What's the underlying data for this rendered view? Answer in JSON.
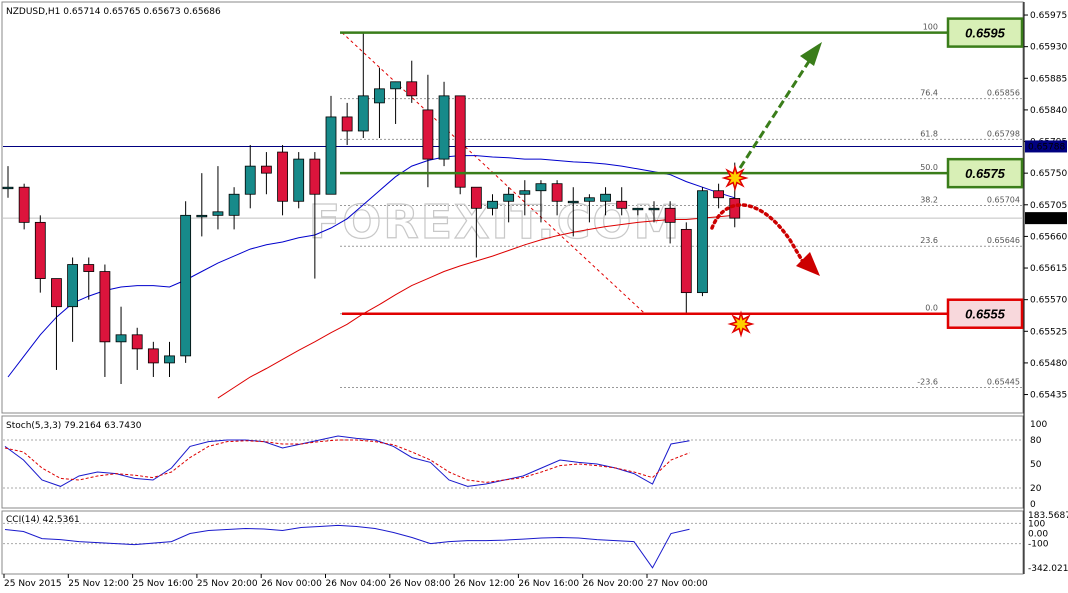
{
  "chart_data": {
    "type": "candlestick",
    "symbol_header": "NZDUSD,H1  0.65714 0.65765 0.65673 0.65686",
    "watermark": "FOREXIT.COM",
    "price_axis": {
      "ticks": [
        "0.65975",
        "0.65930",
        "0.65885",
        "0.65840",
        "0.65795",
        "0.65750",
        "0.65705",
        "0.65660",
        "0.65615",
        "0.65570",
        "0.65525",
        "0.65480",
        "0.65435"
      ],
      "ylim": [
        0.65413,
        0.65985
      ],
      "current_price_label": "0.65686",
      "hline_label": "0.65788"
    },
    "time_axis": {
      "labels": [
        "25 Nov 2015",
        "25 Nov 12:00",
        "25 Nov 16:00",
        "25 Nov 20:00",
        "26 Nov 00:00",
        "26 Nov 04:00",
        "26 Nov 08:00",
        "26 Nov 12:00",
        "26 Nov 16:00",
        "26 Nov 20:00",
        "27 Nov 00:00"
      ]
    },
    "candles": [
      {
        "o": 0.6573,
        "h": 0.6576,
        "l": 0.65715,
        "c": 0.6573
      },
      {
        "o": 0.6573,
        "h": 0.65735,
        "l": 0.6567,
        "c": 0.6568
      },
      {
        "o": 0.6568,
        "h": 0.6569,
        "l": 0.6558,
        "c": 0.656
      },
      {
        "o": 0.656,
        "h": 0.656,
        "l": 0.6547,
        "c": 0.6556
      },
      {
        "o": 0.6556,
        "h": 0.6563,
        "l": 0.6551,
        "c": 0.6562
      },
      {
        "o": 0.6562,
        "h": 0.6563,
        "l": 0.6557,
        "c": 0.6561
      },
      {
        "o": 0.6561,
        "h": 0.6562,
        "l": 0.6546,
        "c": 0.6551
      },
      {
        "o": 0.6551,
        "h": 0.6556,
        "l": 0.6545,
        "c": 0.6552
      },
      {
        "o": 0.6552,
        "h": 0.6553,
        "l": 0.6547,
        "c": 0.655
      },
      {
        "o": 0.655,
        "h": 0.6551,
        "l": 0.6546,
        "c": 0.6548
      },
      {
        "o": 0.6548,
        "h": 0.6551,
        "l": 0.6546,
        "c": 0.6549
      },
      {
        "o": 0.6549,
        "h": 0.6571,
        "l": 0.6548,
        "c": 0.6569
      },
      {
        "o": 0.6569,
        "h": 0.6575,
        "l": 0.6566,
        "c": 0.6569
      },
      {
        "o": 0.6569,
        "h": 0.6576,
        "l": 0.6567,
        "c": 0.65695
      },
      {
        "o": 0.6569,
        "h": 0.6573,
        "l": 0.6567,
        "c": 0.6572
      },
      {
        "o": 0.6572,
        "h": 0.6579,
        "l": 0.657,
        "c": 0.6576
      },
      {
        "o": 0.6576,
        "h": 0.6578,
        "l": 0.6572,
        "c": 0.6575
      },
      {
        "o": 0.6578,
        "h": 0.6579,
        "l": 0.6569,
        "c": 0.6571
      },
      {
        "o": 0.6571,
        "h": 0.6578,
        "l": 0.657,
        "c": 0.6577
      },
      {
        "o": 0.6577,
        "h": 0.6578,
        "l": 0.656,
        "c": 0.6572
      },
      {
        "o": 0.6572,
        "h": 0.6586,
        "l": 0.6572,
        "c": 0.6583
      },
      {
        "o": 0.6583,
        "h": 0.6585,
        "l": 0.6579,
        "c": 0.6581
      },
      {
        "o": 0.6581,
        "h": 0.6595,
        "l": 0.658,
        "c": 0.6586
      },
      {
        "o": 0.6585,
        "h": 0.659,
        "l": 0.658,
        "c": 0.6587
      },
      {
        "o": 0.6587,
        "h": 0.6588,
        "l": 0.6582,
        "c": 0.6588
      },
      {
        "o": 0.6588,
        "h": 0.6591,
        "l": 0.6585,
        "c": 0.6586
      },
      {
        "o": 0.6584,
        "h": 0.6589,
        "l": 0.6573,
        "c": 0.6577
      },
      {
        "o": 0.6577,
        "h": 0.6588,
        "l": 0.6576,
        "c": 0.6586
      },
      {
        "o": 0.6586,
        "h": 0.6586,
        "l": 0.6572,
        "c": 0.6573
      },
      {
        "o": 0.6573,
        "h": 0.6573,
        "l": 0.6563,
        "c": 0.657
      },
      {
        "o": 0.657,
        "h": 0.6572,
        "l": 0.6569,
        "c": 0.6571
      },
      {
        "o": 0.6571,
        "h": 0.6573,
        "l": 0.6568,
        "c": 0.6572
      },
      {
        "o": 0.6572,
        "h": 0.6574,
        "l": 0.6569,
        "c": 0.65725
      },
      {
        "o": 0.65725,
        "h": 0.6574,
        "l": 0.6568,
        "c": 0.65735
      },
      {
        "o": 0.65735,
        "h": 0.6574,
        "l": 0.6569,
        "c": 0.6571
      },
      {
        "o": 0.6571,
        "h": 0.6573,
        "l": 0.6566,
        "c": 0.6571
      },
      {
        "o": 0.6571,
        "h": 0.6572,
        "l": 0.6568,
        "c": 0.65715
      },
      {
        "o": 0.6571,
        "h": 0.6573,
        "l": 0.6569,
        "c": 0.6572
      },
      {
        "o": 0.6571,
        "h": 0.6573,
        "l": 0.6569,
        "c": 0.657
      },
      {
        "o": 0.657,
        "h": 0.657,
        "l": 0.6569,
        "c": 0.657
      },
      {
        "o": 0.657,
        "h": 0.6571,
        "l": 0.6568,
        "c": 0.657
      },
      {
        "o": 0.657,
        "h": 0.6571,
        "l": 0.6565,
        "c": 0.6568
      },
      {
        "o": 0.6567,
        "h": 0.6568,
        "l": 0.6555,
        "c": 0.6558
      },
      {
        "o": 0.6558,
        "h": 0.6573,
        "l": 0.65575,
        "c": 0.65725
      },
      {
        "o": 0.65725,
        "h": 0.65735,
        "l": 0.657,
        "c": 0.65715
      },
      {
        "o": 0.65714,
        "h": 0.65765,
        "l": 0.65673,
        "c": 0.65686
      }
    ],
    "moving_averages": [
      {
        "color": "#0000cc",
        "values": [
          0.6546,
          0.6549,
          0.6552,
          0.65545,
          0.65565,
          0.65575,
          0.65583,
          0.65588,
          0.6559,
          0.6559,
          0.65588,
          0.65598,
          0.6561,
          0.65622,
          0.65632,
          0.65642,
          0.65648,
          0.65652,
          0.65658,
          0.65662,
          0.65672,
          0.65685,
          0.65705,
          0.65725,
          0.65745,
          0.6576,
          0.65768,
          0.65773,
          0.65775,
          0.65775,
          0.65773,
          0.65772,
          0.6577,
          0.6577,
          0.65768,
          0.65766,
          0.65765,
          0.65763,
          0.6576,
          0.65756,
          0.65752,
          0.65748,
          0.65738,
          0.6573,
          0.65722,
          0.65715
        ]
      },
      {
        "color": "#dd0000",
        "values": [
          null,
          null,
          null,
          null,
          null,
          null,
          null,
          null,
          null,
          null,
          null,
          null,
          null,
          0.6543,
          0.65445,
          0.6546,
          0.65472,
          0.65485,
          0.65498,
          0.6551,
          0.65523,
          0.65535,
          0.6555,
          0.65563,
          0.65577,
          0.6559,
          0.656,
          0.6561,
          0.65618,
          0.65625,
          0.65632,
          0.6564,
          0.65648,
          0.65655,
          0.65661,
          0.65666,
          0.6567,
          0.65674,
          0.65677,
          0.6568,
          0.65682,
          0.65684,
          0.65684,
          0.65686,
          0.65688,
          0.6569
        ]
      }
    ],
    "hlines": [
      {
        "price": 0.6595,
        "color": "#3a7d1a",
        "label": "0.6595"
      },
      {
        "price": 0.6575,
        "color": "#3a7d1a",
        "label": "0.6575"
      },
      {
        "price": 0.6555,
        "color": "#e00000",
        "label": "0.6555"
      }
    ],
    "fib_levels": [
      {
        "label": "100",
        "price_label": "",
        "price": 0.6595
      },
      {
        "label": "76.4",
        "price_label": "0.65856",
        "price": 0.65856
      },
      {
        "label": "61.8",
        "price_label": "0.65798",
        "price": 0.65798
      },
      {
        "label": "50.0",
        "price_label": "",
        "price": 0.6575
      },
      {
        "label": "38.2",
        "price_label": "0.65704",
        "price": 0.65704
      },
      {
        "label": "23.6",
        "price_label": "0.65646",
        "price": 0.65646
      },
      {
        "label": "0.0",
        "price_label": "",
        "price": 0.6555
      },
      {
        "label": "-23.6",
        "price_label": "0.65445",
        "price": 0.65445
      }
    ],
    "stoch": {
      "label": "Stoch(5,3,3) 79.2164 63.7430",
      "ticks": [
        "100",
        "80",
        "50",
        "20",
        "0"
      ],
      "main": [
        72,
        55,
        30,
        22,
        35,
        40,
        38,
        32,
        30,
        45,
        72,
        78,
        80,
        80,
        78,
        70,
        75,
        80,
        85,
        82,
        80,
        72,
        58,
        52,
        30,
        22,
        25,
        30,
        35,
        45,
        55,
        52,
        50,
        45,
        38,
        25,
        75,
        79
      ],
      "signal": [
        70,
        65,
        45,
        32,
        30,
        35,
        38,
        36,
        33,
        40,
        58,
        72,
        78,
        79,
        78,
        75,
        75,
        78,
        80,
        80,
        78,
        74,
        65,
        55,
        40,
        30,
        27,
        30,
        33,
        40,
        48,
        50,
        48,
        45,
        40,
        33,
        55,
        64
      ]
    },
    "cci": {
      "label": "CCI(14) 42.5361",
      "ticks": [
        "183.5687",
        "100",
        "0.00",
        "-100",
        "-342.0218"
      ],
      "values": [
        40,
        20,
        -50,
        -60,
        -80,
        -90,
        -100,
        -110,
        -95,
        -80,
        0,
        30,
        40,
        50,
        45,
        30,
        60,
        70,
        80,
        70,
        50,
        10,
        -40,
        -100,
        -80,
        -70,
        -70,
        -65,
        -55,
        -45,
        -40,
        -45,
        -60,
        -70,
        -80,
        -340,
        0,
        42
      ]
    },
    "annotations": [
      {
        "type": "arrow",
        "style": "dashed",
        "color": "#3a7d1a",
        "direction": "up"
      },
      {
        "type": "arrow",
        "style": "dotted",
        "color": "#cc0000",
        "direction": "down"
      }
    ]
  }
}
